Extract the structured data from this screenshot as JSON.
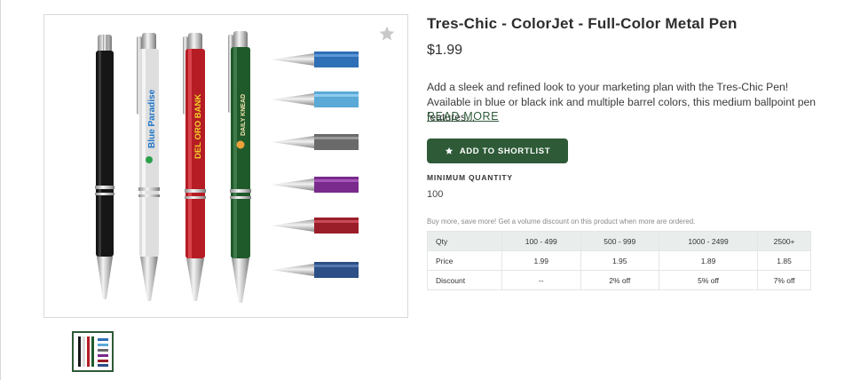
{
  "product": {
    "title": "Tres-Chic - ColorJet - Full-Color Metal Pen",
    "price": "$1.99",
    "description": "Add a sleek and refined look to your marketing plan with the Tres-Chic Pen! Available in blue or black ink and multiple barrel colors, this medium ballpoint pen features...",
    "read_more_label": "READ MORE",
    "shortlist_button_label": "ADD TO SHORTLIST",
    "minimum_quantity_label": "MINIMUM QUANTITY",
    "minimum_quantity_value": "100",
    "volume_note": "Buy more, save more! Get a volume discount on this product when more are ordered."
  },
  "image": {
    "pen_imprints": [
      "Blue Paradise",
      "DEL ORO BANK",
      "DAILY KNEAD"
    ],
    "pen_barrel_colors": [
      "#161616",
      "#dcdcdc",
      "#b51c24",
      "#1f5a2b"
    ],
    "tip_colors": [
      "#2f6fb5",
      "#5aa9d6",
      "#6a6a6a",
      "#7a2a8c",
      "#9a1e2a",
      "#2c4f86"
    ],
    "star_icon": "star-outline-icon"
  },
  "pricing_table": {
    "headers": [
      "Qty",
      "100 - 499",
      "500 - 999",
      "1000 - 2499",
      "2500+"
    ],
    "rows": [
      [
        "Price",
        "1.99",
        "1.95",
        "1.89",
        "1.85"
      ],
      [
        "Discount",
        "--",
        "2% off",
        "5% off",
        "7% off"
      ]
    ]
  },
  "colors": {
    "accent": "#2e5a37",
    "table_header_bg": "#e9eeec"
  }
}
